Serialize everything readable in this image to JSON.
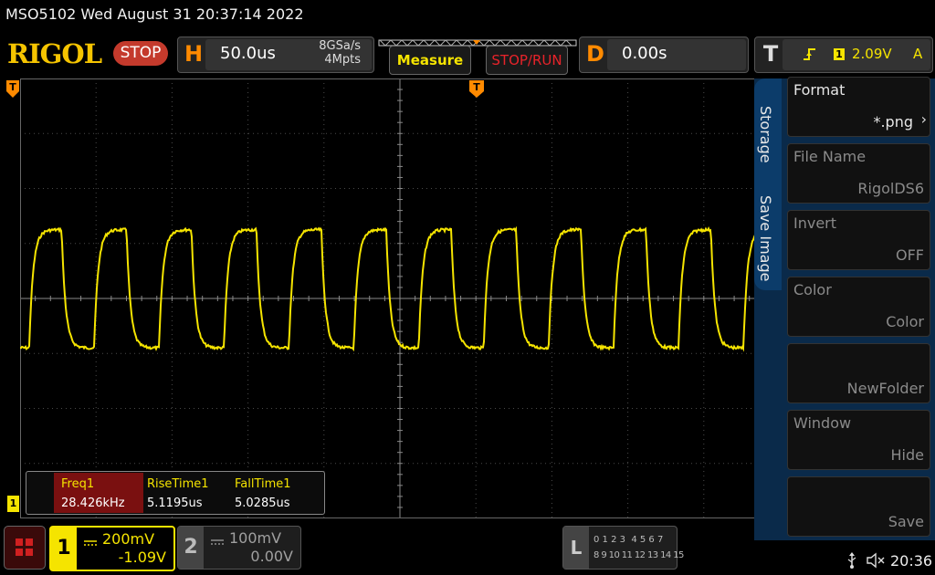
{
  "header": {
    "title": "MSO5102  Wed August 31 20:37:14 2022",
    "logo": "RIGOL",
    "run_state": "STOP",
    "horizontal": {
      "letter": "H",
      "timebase": "50.0us",
      "sample_rate": "8GSa/s",
      "memory_depth": "4Mpts"
    },
    "measure_label": "Measure",
    "stoprun_label": "STOP/RUN",
    "delay": {
      "letter": "D",
      "value": "0.00s"
    },
    "trigger": {
      "letter": "T",
      "channel": "1",
      "level": "2.09V",
      "mode": "A"
    }
  },
  "grid": {
    "cols": 10,
    "rows": 8
  },
  "waveform": {
    "color": "#f5e400",
    "periods_visible": 11.7,
    "high_level_div": 1.25,
    "low_level_div": -0.9,
    "edge_time_fraction": 0.33,
    "trigger_level_marker": "T",
    "ch1_marker": "1"
  },
  "measurements": {
    "items": [
      {
        "name": "Freq1",
        "value": "28.426kHz"
      },
      {
        "name": "RiseTime1",
        "value": "5.1195us"
      },
      {
        "name": "FallTime1",
        "value": "5.0285us"
      }
    ]
  },
  "menu": {
    "tabs": [
      "Storage",
      "Save Image"
    ],
    "items": [
      {
        "label": "Format",
        "value": "*.png",
        "enabled": true,
        "has_arrow": true
      },
      {
        "label": "File Name",
        "value": "RigolDS6",
        "enabled": false
      },
      {
        "label": "Invert",
        "value": "OFF",
        "enabled": false
      },
      {
        "label": "Color",
        "value": "Color",
        "enabled": false
      },
      {
        "label": "",
        "value": "NewFolder",
        "enabled": false
      },
      {
        "label": "Window",
        "value": "Hide",
        "enabled": false
      },
      {
        "label": "",
        "value": "Save",
        "enabled": false
      }
    ]
  },
  "channels": [
    {
      "num": "1",
      "scale": "200mV",
      "offset": "-1.09V",
      "active": true,
      "color": "#f5e400"
    },
    {
      "num": "2",
      "scale": "100mV",
      "offset": "0.00V",
      "active": false,
      "color": "#8f8f8f"
    }
  ],
  "logic": {
    "letter": "L",
    "row1": "0 1 2 3  4 5 6 7",
    "row2": "8 9 10 11 12 13 14 15"
  },
  "status": {
    "time": "20:36",
    "usb_icon": "usb-icon",
    "sound_icon": "speaker-muted-icon"
  }
}
